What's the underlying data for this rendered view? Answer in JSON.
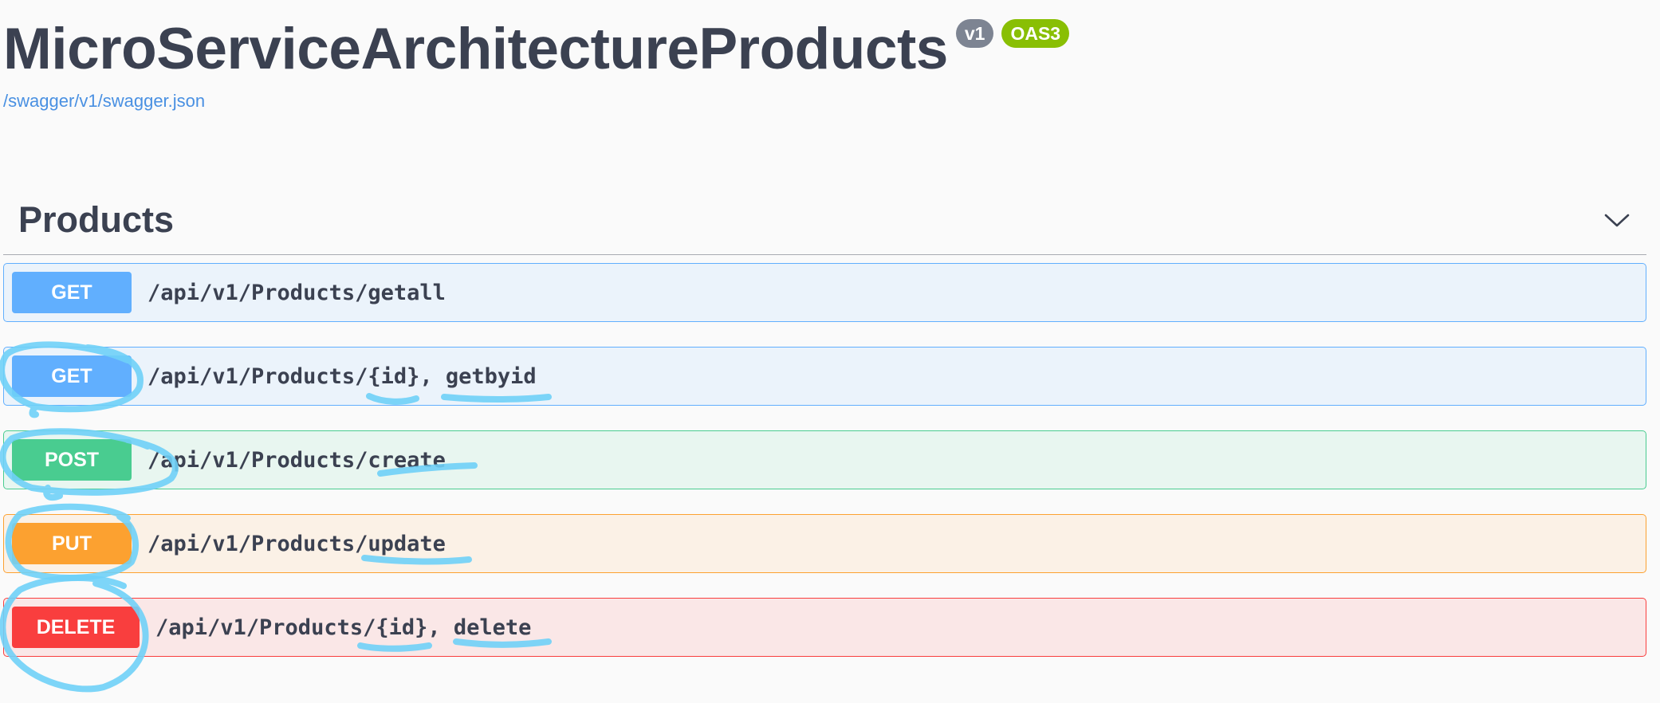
{
  "info": {
    "title": "MicroServiceArchitectureProducts",
    "version_badge": "v1",
    "oas_badge": "OAS3",
    "spec_link": "/swagger/v1/swagger.json"
  },
  "section": {
    "title": "Products",
    "toggle_icon": "chevron-down-icon"
  },
  "operations": [
    {
      "method": "GET",
      "path": "/api/v1/Products/getall"
    },
    {
      "method": "GET",
      "path": "/api/v1/Products/{id}, getbyid"
    },
    {
      "method": "POST",
      "path": "/api/v1/Products/create"
    },
    {
      "method": "PUT",
      "path": "/api/v1/Products/update"
    },
    {
      "method": "DELETE",
      "path": "/api/v1/Products/{id}, delete"
    }
  ],
  "colors": {
    "get": "#61affe",
    "post": "#49cc90",
    "put": "#fca130",
    "delete": "#f93e3e",
    "annotation": "#6fd0f7",
    "oas_badge": "#89bf04",
    "version_badge": "#7d8492"
  }
}
